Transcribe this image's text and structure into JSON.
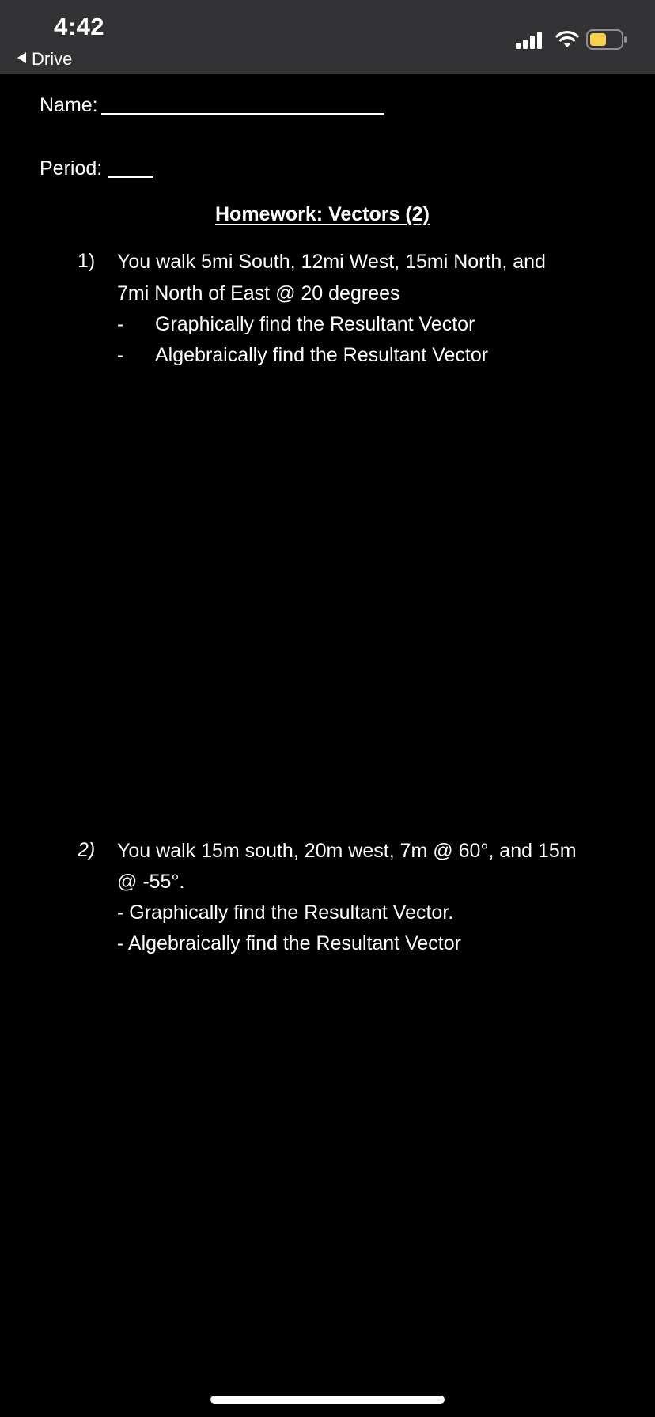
{
  "status_bar": {
    "time": "4:42",
    "back_label": "Drive",
    "icons": [
      "cellular-signal-icon",
      "wifi-icon",
      "battery-icon"
    ],
    "battery_color": "#f7d24a",
    "background": "#333336"
  },
  "document": {
    "name_label": "Name:",
    "period_label": "Period:",
    "title": "Homework: Vectors (2)",
    "questions": [
      {
        "number": "1)",
        "lines": [
          "You walk 5mi South, 12mi West, 15mi North, and",
          "7mi North of East @ 20 degrees"
        ],
        "bullets": [
          {
            "marker": "-",
            "text": "Graphically find the Resultant Vector"
          },
          {
            "marker": "-",
            "text": "Algebraically find the Resultant Vector"
          }
        ]
      },
      {
        "number": "2)",
        "lines": [
          "You walk 15m south, 20m west, 7m @ 60°, and 15m",
          "@ -55°.",
          "- Graphically find the Resultant Vector.",
          "- Algebraically find the Resultant Vector"
        ]
      }
    ]
  }
}
